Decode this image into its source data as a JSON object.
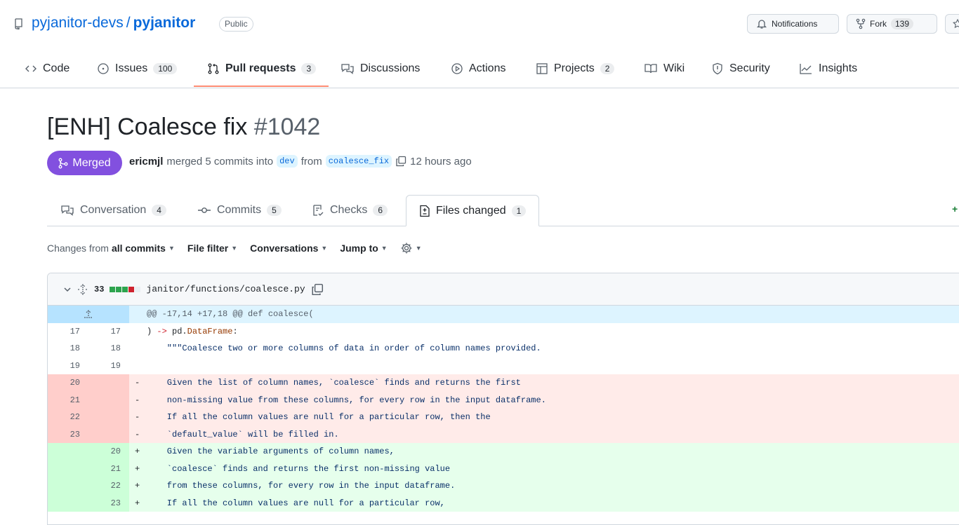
{
  "repo": {
    "owner": "pyjanitor-devs",
    "separator": "/",
    "name": "pyjanitor",
    "visibility": "Public",
    "notifications_label": "Notifications",
    "fork_label": "Fork",
    "fork_count": "139"
  },
  "nav": {
    "code": "Code",
    "issues": "Issues",
    "issues_count": "100",
    "pull_requests": "Pull requests",
    "pull_requests_count": "3",
    "discussions": "Discussions",
    "actions": "Actions",
    "projects": "Projects",
    "projects_count": "2",
    "wiki": "Wiki",
    "security": "Security",
    "insights": "Insights"
  },
  "pr": {
    "title": "[ENH] Coalesce fix",
    "number": "#1042",
    "state": "Merged",
    "author": "ericmjl",
    "merge_text": "merged 5 commits into",
    "base_branch": "dev",
    "from_text": "from",
    "head_branch": "coalesce_fix",
    "time": "12 hours ago"
  },
  "tabs": {
    "conversation": "Conversation",
    "conversation_count": "4",
    "commits": "Commits",
    "commits_count": "5",
    "checks": "Checks",
    "checks_count": "6",
    "files_changed": "Files changed",
    "files_changed_count": "1",
    "right_edge_glyph": "+"
  },
  "toolbar": {
    "changes_from": "Changes from",
    "all_commits": "all commits",
    "file_filter": "File filter",
    "conversations": "Conversations",
    "jump_to": "Jump to"
  },
  "file": {
    "changes": "33",
    "path": "janitor/functions/coalesce.py",
    "diffstat_colors": [
      "#2da44e",
      "#2da44e",
      "#2da44e",
      "#cf222e",
      "#eaeef2"
    ],
    "hunk_header": "@@ -17,14 +17,18 @@ def coalesce(",
    "lines": [
      {
        "type": "context",
        "old": "17",
        "new": "17",
        "sign": "",
        "code": ") -> pd.DataFrame:"
      },
      {
        "type": "context",
        "old": "18",
        "new": "18",
        "sign": "",
        "code": "    \"\"\"Coalesce two or more columns of data in order of column names provided."
      },
      {
        "type": "context",
        "old": "19",
        "new": "19",
        "sign": "",
        "code": ""
      },
      {
        "type": "del",
        "old": "20",
        "new": "",
        "sign": "-",
        "code": "    Given the list of column names, `coalesce` finds and returns the first"
      },
      {
        "type": "del",
        "old": "21",
        "new": "",
        "sign": "-",
        "code": "    non-missing value from these columns, for every row in the input dataframe."
      },
      {
        "type": "del",
        "old": "22",
        "new": "",
        "sign": "-",
        "code": "    If all the column values are null for a particular row, then the"
      },
      {
        "type": "del",
        "old": "23",
        "new": "",
        "sign": "-",
        "code": "    `default_value` will be filled in."
      },
      {
        "type": "add",
        "old": "",
        "new": "20",
        "sign": "+",
        "code": "    Given the variable arguments of column names,"
      },
      {
        "type": "add",
        "old": "",
        "new": "21",
        "sign": "+",
        "code": "    `coalesce` finds and returns the first non-missing value"
      },
      {
        "type": "add",
        "old": "",
        "new": "22",
        "sign": "+",
        "code": "    from these columns, for every row in the input dataframe."
      },
      {
        "type": "add",
        "old": "",
        "new": "23",
        "sign": "+",
        "code": "    If all the column values are null for a particular row,"
      }
    ]
  }
}
